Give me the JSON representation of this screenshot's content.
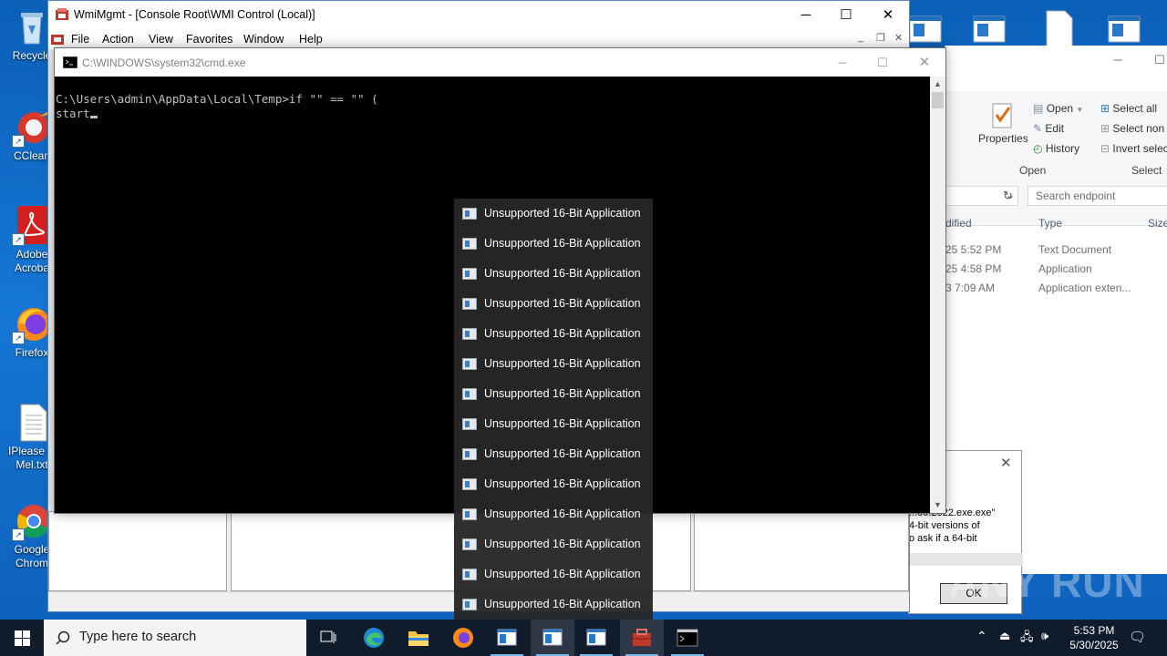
{
  "desktop": {
    "icons": [
      {
        "label": "Recycle"
      },
      {
        "label": "CClean"
      },
      {
        "label": "Adobe Acroba"
      },
      {
        "label": "Firefox"
      },
      {
        "label": "IPlease R Mel.txt"
      },
      {
        "label": "Google Chrom"
      }
    ]
  },
  "mmc": {
    "title": "WmiMgmt - [Console Root\\WMI Control (Local)]",
    "menu": [
      "File",
      "Action",
      "View",
      "Favorites",
      "Window",
      "Help"
    ]
  },
  "cmd": {
    "title": "C:\\WINDOWS\\system32\\cmd.exe",
    "line1": "C:\\Users\\admin\\AppData\\Local\\Temp>if \"\" == \"\" (",
    "line2": "start"
  },
  "popup": {
    "items": [
      "Unsupported 16-Bit Application",
      "Unsupported 16-Bit Application",
      "Unsupported 16-Bit Application",
      "Unsupported 16-Bit Application",
      "Unsupported 16-Bit Application",
      "Unsupported 16-Bit Application",
      "Unsupported 16-Bit Application",
      "Unsupported 16-Bit Application",
      "Unsupported 16-Bit Application",
      "Unsupported 16-Bit Application",
      "Unsupported 16-Bit Application",
      "Unsupported 16-Bit Application",
      "Unsupported 16-Bit Application",
      "Unsupported 16-Bit Application"
    ]
  },
  "explorer": {
    "ribbon": {
      "properties": "Properties",
      "open": "Open",
      "edit": "Edit",
      "history": "History",
      "group_open": "Open",
      "select_all": "Select all",
      "select_none": "Select non",
      "invert": "Invert selec",
      "group_select": "Select"
    },
    "search_placeholder": "Search endpoint",
    "columns": {
      "modified": "dified",
      "type": "Type",
      "size": "Size"
    },
    "rows": [
      {
        "date": "25 5:52 PM",
        "type": "Text Document"
      },
      {
        "date": "25 4:58 PM",
        "type": "Application"
      },
      {
        "date": "3 7:09 AM",
        "type": "Application exten..."
      }
    ]
  },
  "dialog": {
    "line1": "...00.2022.exe.exe\"",
    "line2": "4-bit versions of",
    "line3": "o ask if a 64-bit",
    "ok": "OK"
  },
  "watermark": "ANY RUN",
  "taskbar": {
    "search_placeholder": "Type here to search",
    "time": "5:53 PM",
    "date": "5/30/2025"
  },
  "colors": {
    "desktop": "#1577d4",
    "taskbar": "#101c2c",
    "console_bg": "#000000",
    "popup_bg": "#262626"
  }
}
